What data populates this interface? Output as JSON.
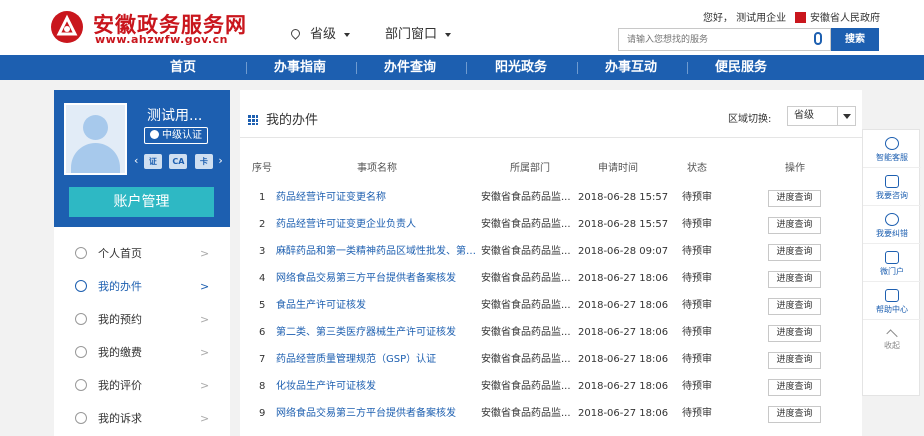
{
  "header": {
    "logo_cn": "安徽政务服务网",
    "logo_en": "www.ahzwfw.gov.cn",
    "location": "省级",
    "department": "部门窗口",
    "greeting": "您好，  测试用企业",
    "gov_link": "安徽省人民政府",
    "search_placeholder": "请输入您想找的服务",
    "search_button": "搜索"
  },
  "nav": {
    "items": [
      "首页",
      "办事指南",
      "办件查询",
      "阳光政务",
      "办事互动",
      "便民服务"
    ]
  },
  "profile": {
    "username": "测试用...",
    "cert_badge": "中级认证",
    "auth_left": "‹",
    "auth_chip_1": "证",
    "auth_chip_2": "CA",
    "auth_chip_3": "卡",
    "auth_right": "›",
    "account_button": "账户管理"
  },
  "sidebar": {
    "items": [
      {
        "label": "个人首页",
        "arrow": ">"
      },
      {
        "label": "我的办件",
        "arrow": ">"
      },
      {
        "label": "我的预约",
        "arrow": ">"
      },
      {
        "label": "我的缴费",
        "arrow": ">"
      },
      {
        "label": "我的评价",
        "arrow": ">"
      },
      {
        "label": "我的诉求",
        "arrow": ">"
      }
    ],
    "active_index": 1
  },
  "main": {
    "title": "我的办件",
    "region_label": "区域切换:",
    "region_value": "省级",
    "columns": [
      "序号",
      "事项名称",
      "所属部门",
      "申请时间",
      "状态",
      "操作"
    ],
    "rows": [
      {
        "num": "1",
        "name": "药品经营许可证变更名称",
        "dept": "安徽省食品药品监...",
        "time": "2018-06-28 15:57",
        "status": "待预审",
        "op": "进度查询"
      },
      {
        "num": "2",
        "name": "药品经营许可证变更企业负责人",
        "dept": "安徽省食品药品监...",
        "time": "2018-06-28 15:57",
        "status": "待预审",
        "op": "进度查询"
      },
      {
        "num": "3",
        "name": "麻醉药品和第一类精神药品区域性批发、第二...",
        "dept": "安徽省食品药品监...",
        "time": "2018-06-28 09:07",
        "status": "待预审",
        "op": "进度查询"
      },
      {
        "num": "4",
        "name": "网络食品交易第三方平台提供者备案核发",
        "dept": "安徽省食品药品监...",
        "time": "2018-06-27 18:06",
        "status": "待预审",
        "op": "进度查询"
      },
      {
        "num": "5",
        "name": "食品生产许可证核发",
        "dept": "安徽省食品药品监...",
        "time": "2018-06-27 18:06",
        "status": "待预审",
        "op": "进度查询"
      },
      {
        "num": "6",
        "name": "第二类、第三类医疗器械生产许可证核发",
        "dept": "安徽省食品药品监...",
        "time": "2018-06-27 18:06",
        "status": "待预审",
        "op": "进度查询"
      },
      {
        "num": "7",
        "name": "药品经营质量管理规范（GSP）认证",
        "dept": "安徽省食品药品监...",
        "time": "2018-06-27 18:06",
        "status": "待预审",
        "op": "进度查询"
      },
      {
        "num": "8",
        "name": "化妆品生产许可证核发",
        "dept": "安徽省食品药品监...",
        "time": "2018-06-27 18:06",
        "status": "待预审",
        "op": "进度查询"
      },
      {
        "num": "9",
        "name": "网络食品交易第三方平台提供者备案核发",
        "dept": "安徽省食品药品监...",
        "time": "2018-06-27 18:06",
        "status": "待预审",
        "op": "进度查询"
      }
    ]
  },
  "float_bar": {
    "items": [
      "智能客服",
      "我要咨询",
      "我要纠错",
      "微门户",
      "帮助中心",
      "收起"
    ]
  },
  "colors": {
    "brand_red": "#c9161d",
    "nav_blue": "#1d5fb0",
    "account_teal": "#2eb8c4"
  }
}
